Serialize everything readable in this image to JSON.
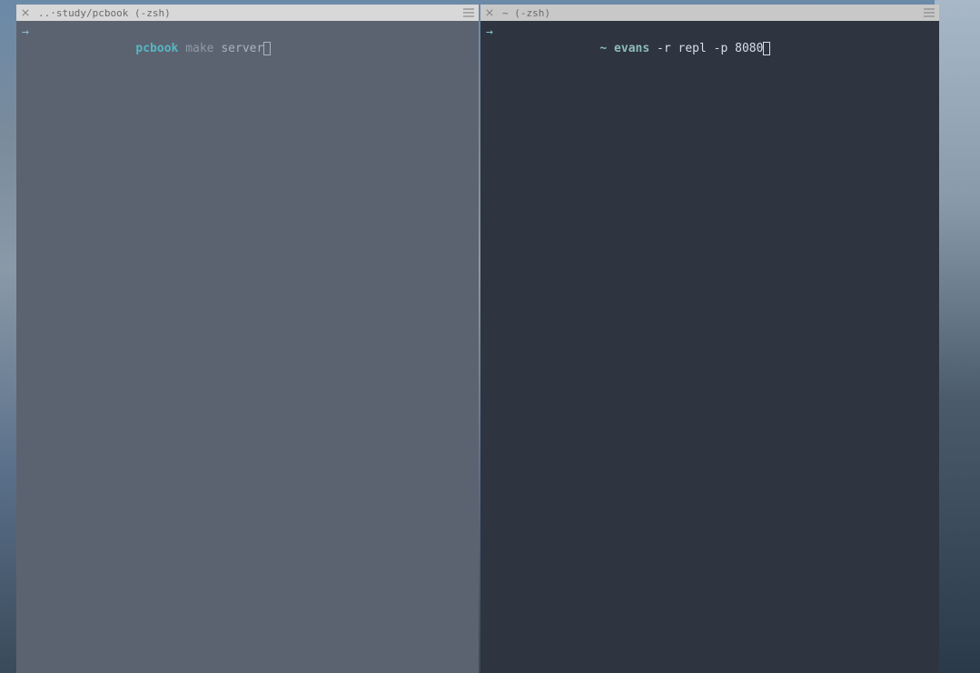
{
  "panes": {
    "left": {
      "tab": {
        "title": "..·study/pcbook (-zsh)"
      },
      "prompt": {
        "arrow": "→",
        "dir": "pcbook",
        "dim_text": " make ",
        "command": "server"
      }
    },
    "right": {
      "tab": {
        "title": "~ (-zsh)"
      },
      "prompt": {
        "arrow": "→",
        "dir": "~",
        "exec": " evans",
        "command": " -r repl -p 8080"
      }
    }
  }
}
